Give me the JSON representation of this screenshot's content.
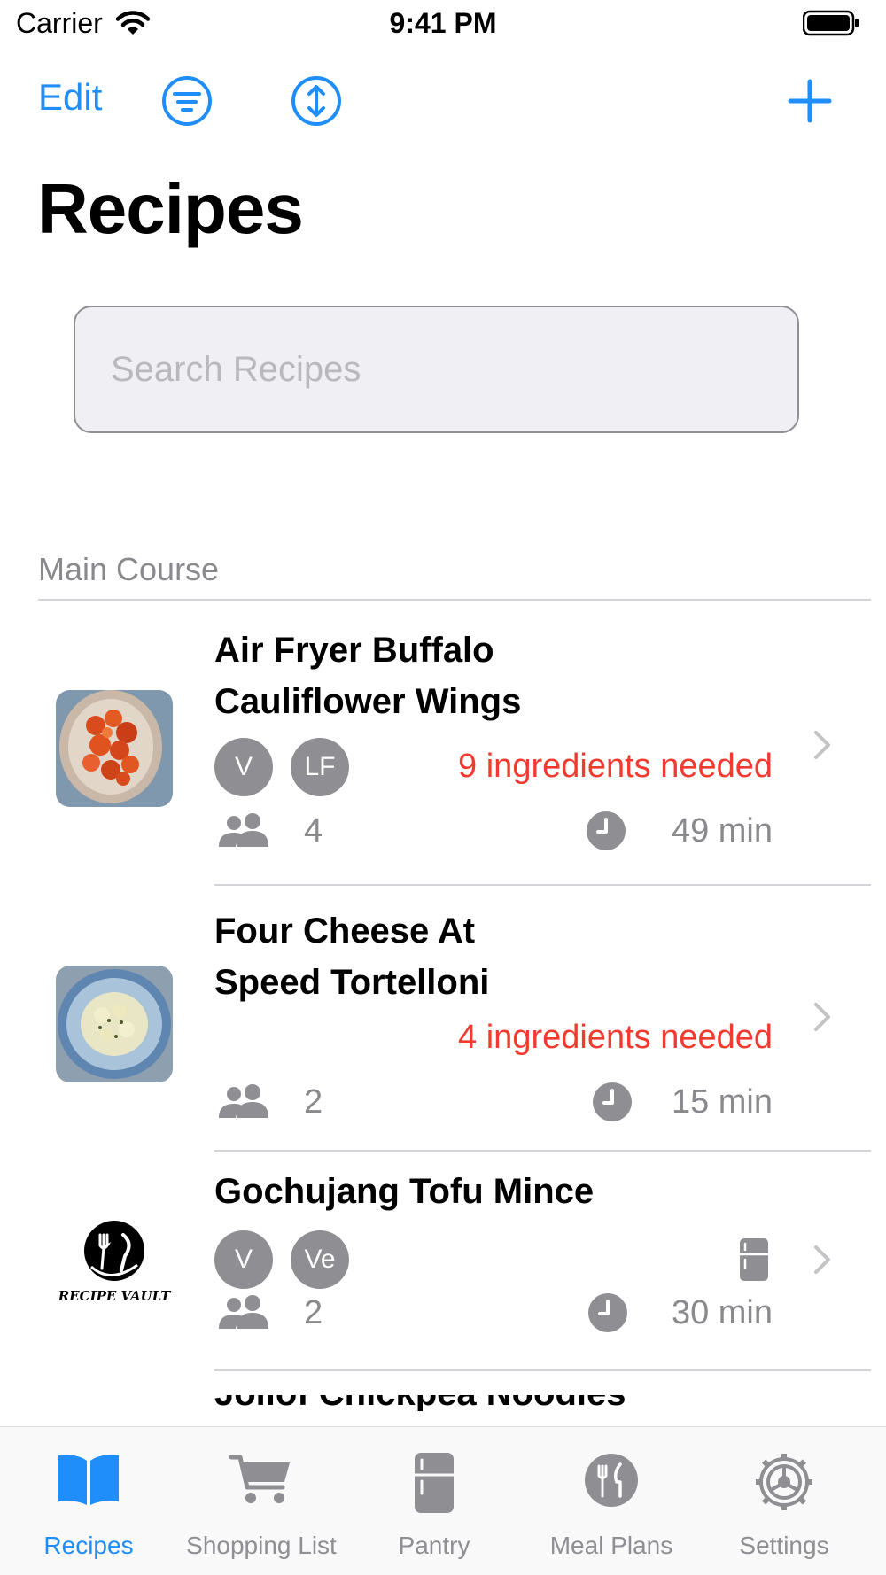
{
  "status_bar": {
    "carrier": "Carrier",
    "time": "9:41 PM"
  },
  "nav": {
    "edit_label": "Edit",
    "filter_icon": "filter-lines-circle-icon",
    "sort_icon": "sort-arrows-circle-icon",
    "add_icon": "plus-icon"
  },
  "page_title": "Recipes",
  "search": {
    "placeholder": "Search Recipes",
    "value": ""
  },
  "section": {
    "title": "Main Course"
  },
  "recipes": [
    {
      "title_line1": "Air Fryer Buffalo",
      "title_line2": "Cauliflower Wings",
      "badges": [
        "V",
        "LF"
      ],
      "ingredients_needed": "9 ingredients needed",
      "servings": "4",
      "time": "49 min"
    },
    {
      "title_line1": "Four Cheese At",
      "title_line2": "Speed Tortelloni",
      "badges": [],
      "ingredients_needed": "4 ingredients needed",
      "servings": "2",
      "time": "15 min"
    },
    {
      "title_line1": "Gochujang Tofu Mince",
      "badges": [
        "V",
        "Ve"
      ],
      "pantry_icon": "fridge-icon",
      "servings": "2",
      "time": "30 min",
      "placeholder_logo_text": "RECIPE VAULT"
    },
    {
      "title_partial": "Jollof Chickpea Noodles"
    }
  ],
  "tabs": [
    {
      "label": "Recipes",
      "icon": "open-book-icon",
      "active": true
    },
    {
      "label": "Shopping List",
      "icon": "cart-icon",
      "active": false
    },
    {
      "label": "Pantry",
      "icon": "fridge-icon",
      "active": false
    },
    {
      "label": "Meal Plans",
      "icon": "fork-knife-circle-icon",
      "active": false
    },
    {
      "label": "Settings",
      "icon": "gear-icon",
      "active": false
    }
  ],
  "colors": {
    "accent": "#1f8efa",
    "warning": "#f23b30",
    "secondary": "#8e8e93",
    "badge": "#8e8e93"
  }
}
